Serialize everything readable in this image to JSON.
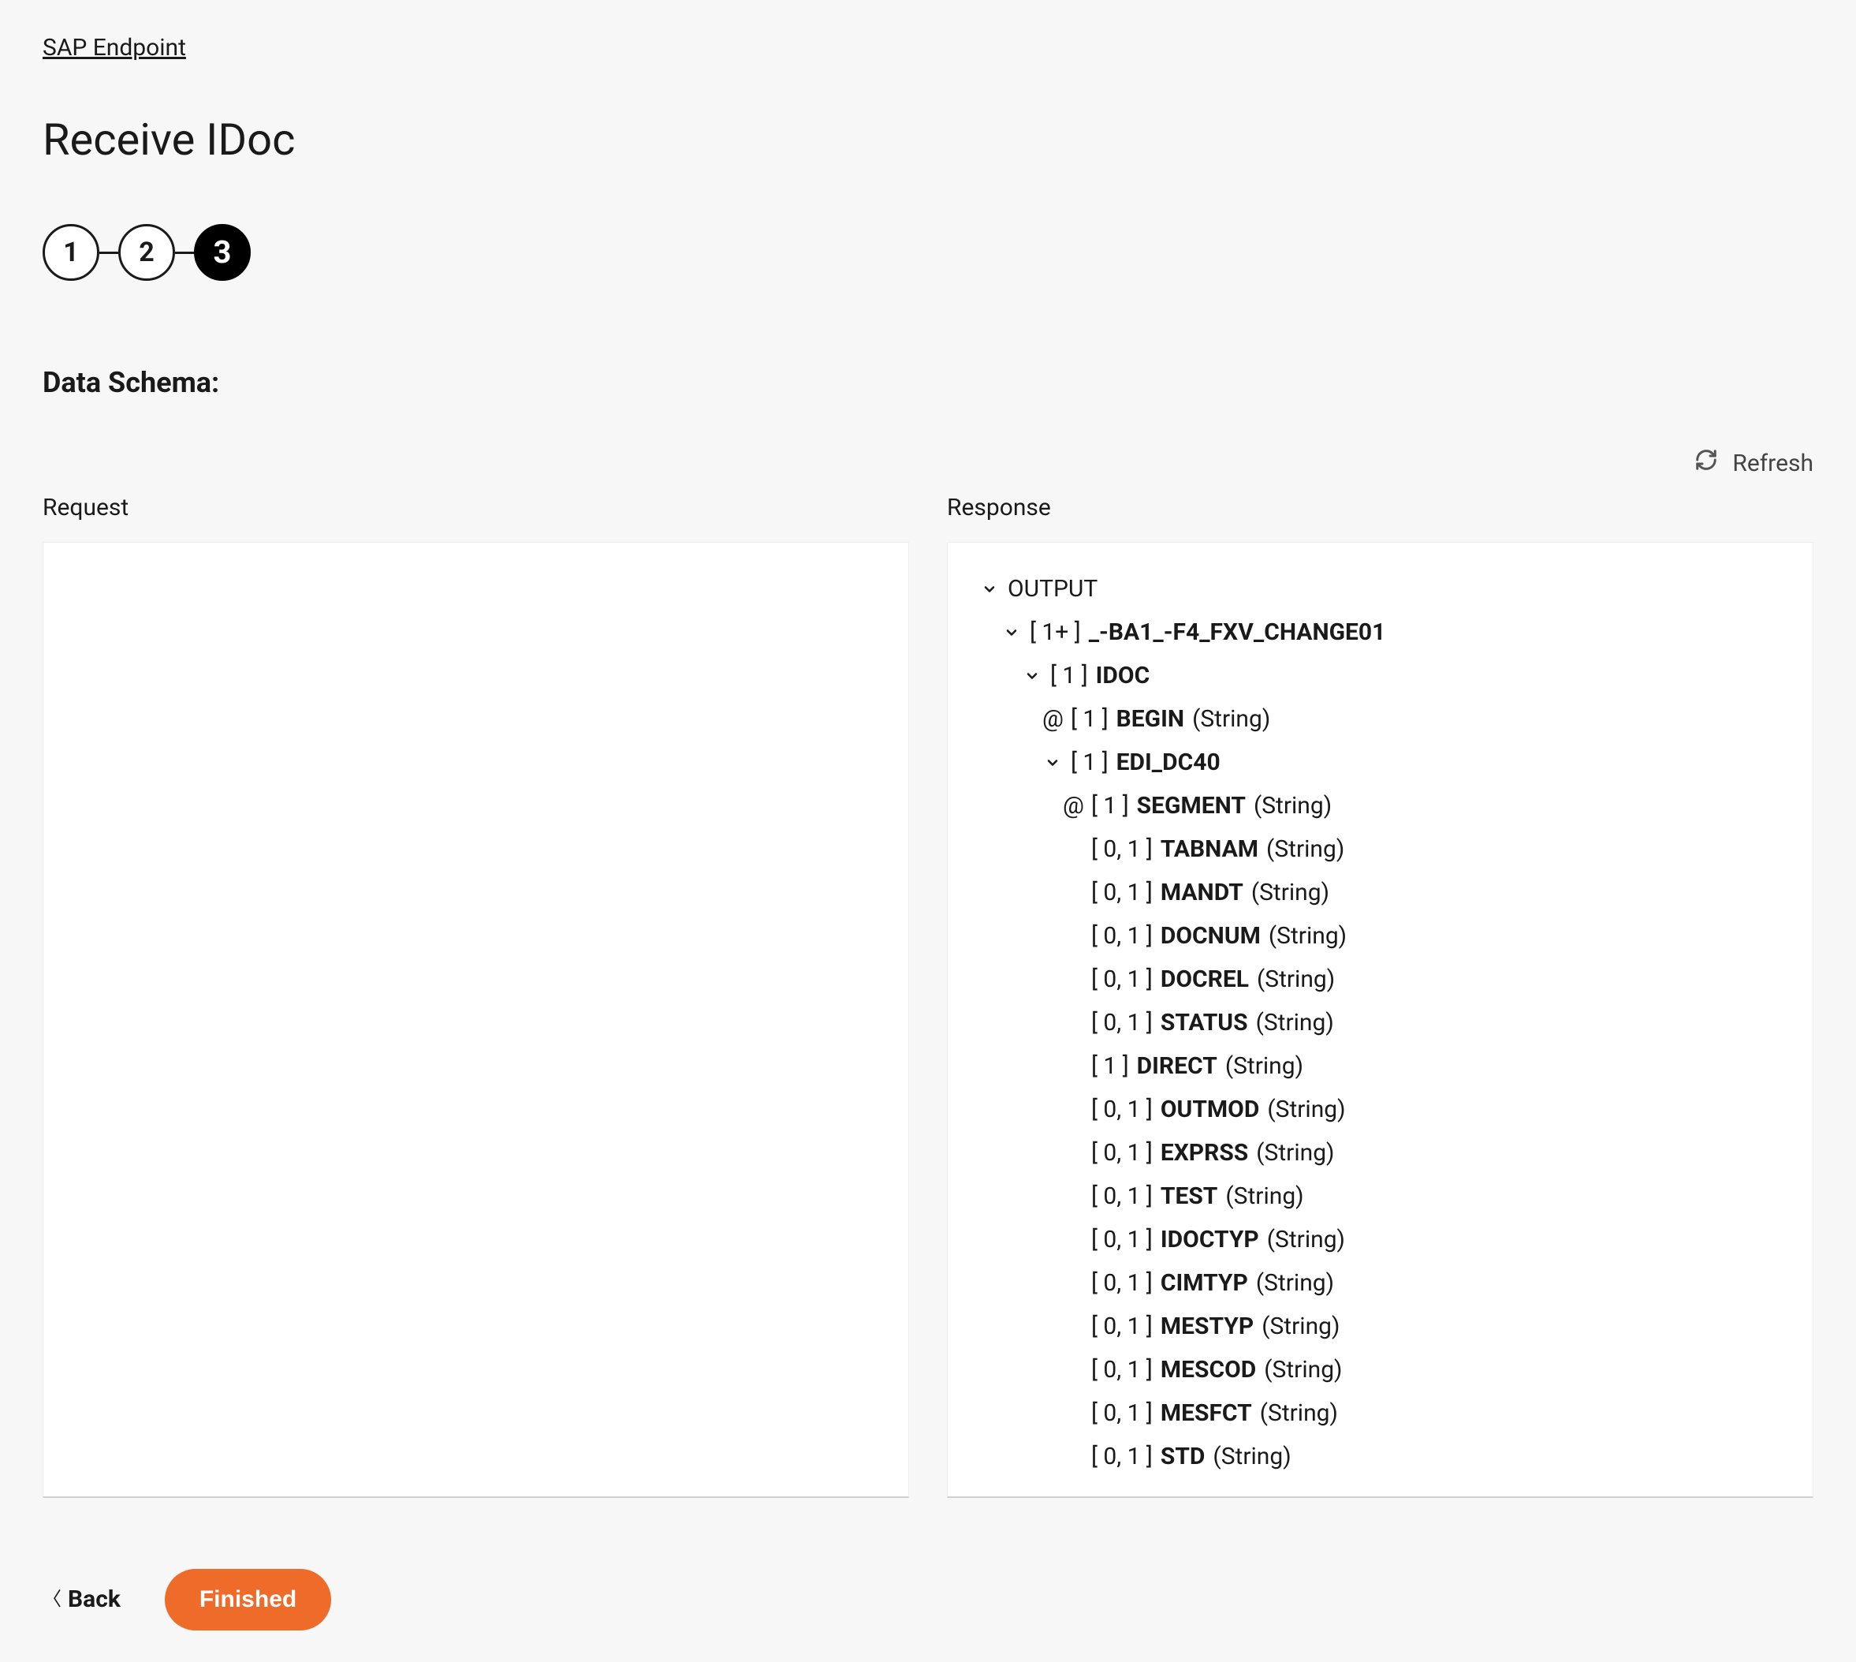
{
  "breadcrumb": "SAP Endpoint",
  "page_title": "Receive IDoc",
  "stepper": {
    "steps": [
      "1",
      "2",
      "3"
    ],
    "active_index": 2
  },
  "section_title": "Data Schema:",
  "refresh_label": "Refresh",
  "columns": {
    "request_label": "Request",
    "response_label": "Response"
  },
  "tree": {
    "root": {
      "label": "OUTPUT"
    },
    "level1": {
      "card": "[ 1+ ]",
      "name": "_-BA1_-F4_FXV_CHANGE01"
    },
    "level2": {
      "card": "[ 1 ]",
      "name": "IDOC"
    },
    "begin": {
      "card": "[ 1 ]",
      "name": "BEGIN",
      "type": "(String)"
    },
    "edi": {
      "card": "[ 1 ]",
      "name": "EDI_DC40"
    },
    "leaves": [
      {
        "at": true,
        "card": "[ 1 ]",
        "name": "SEGMENT",
        "type": "(String)"
      },
      {
        "at": false,
        "card": "[ 0, 1 ]",
        "name": "TABNAM",
        "type": "(String)"
      },
      {
        "at": false,
        "card": "[ 0, 1 ]",
        "name": "MANDT",
        "type": "(String)"
      },
      {
        "at": false,
        "card": "[ 0, 1 ]",
        "name": "DOCNUM",
        "type": "(String)"
      },
      {
        "at": false,
        "card": "[ 0, 1 ]",
        "name": "DOCREL",
        "type": "(String)"
      },
      {
        "at": false,
        "card": "[ 0, 1 ]",
        "name": "STATUS",
        "type": "(String)"
      },
      {
        "at": false,
        "card": "[ 1 ]",
        "name": "DIRECT",
        "type": "(String)"
      },
      {
        "at": false,
        "card": "[ 0, 1 ]",
        "name": "OUTMOD",
        "type": "(String)"
      },
      {
        "at": false,
        "card": "[ 0, 1 ]",
        "name": "EXPRSS",
        "type": "(String)"
      },
      {
        "at": false,
        "card": "[ 0, 1 ]",
        "name": "TEST",
        "type": "(String)"
      },
      {
        "at": false,
        "card": "[ 0, 1 ]",
        "name": "IDOCTYP",
        "type": "(String)"
      },
      {
        "at": false,
        "card": "[ 0, 1 ]",
        "name": "CIMTYP",
        "type": "(String)"
      },
      {
        "at": false,
        "card": "[ 0, 1 ]",
        "name": "MESTYP",
        "type": "(String)"
      },
      {
        "at": false,
        "card": "[ 0, 1 ]",
        "name": "MESCOD",
        "type": "(String)"
      },
      {
        "at": false,
        "card": "[ 0, 1 ]",
        "name": "MESFCT",
        "type": "(String)"
      },
      {
        "at": false,
        "card": "[ 0, 1 ]",
        "name": "STD",
        "type": "(String)"
      }
    ]
  },
  "footer": {
    "back": "Back",
    "finished": "Finished"
  }
}
